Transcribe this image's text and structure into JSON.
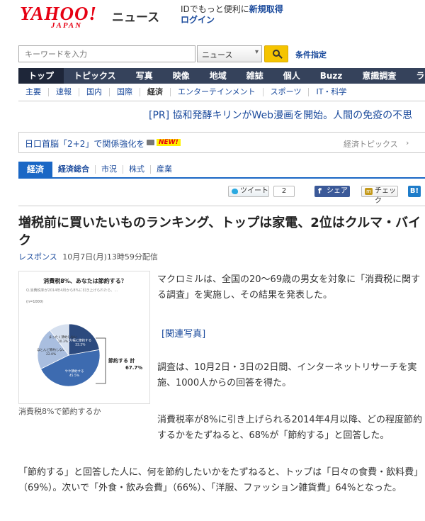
{
  "header": {
    "logo_main": "YAHOO!",
    "logo_sub": "JAPAN",
    "logo_news": "ニュース",
    "account_text": "IDでもっと便利に",
    "register_link": "新規取得",
    "login_link": "ログイン"
  },
  "search": {
    "placeholder": "キーワードを入力",
    "category": "ニュース",
    "options_link": "条件指定"
  },
  "main_nav": [
    "トップ",
    "トピックス",
    "写真",
    "映像",
    "地域",
    "雑誌",
    "個人",
    "Buzz",
    "意識調査",
    "ランキ"
  ],
  "sub_nav": [
    "主要",
    "速報",
    "国内",
    "国際",
    "経済",
    "エンターテインメント",
    "スポーツ",
    "IT・科学"
  ],
  "pr_text": "[PR] 協和発酵キリンがWeb漫画を開始。人間の免疫の不思",
  "topic": {
    "headline": "日口首脳「2+2」で関係強化を",
    "new_badge": "NEW!",
    "right_label": "経済トピックス"
  },
  "category_bar": {
    "tab": "経済",
    "items": [
      "経済総合",
      "市況",
      "株式",
      "産業"
    ]
  },
  "share": {
    "tweet_label": "ツイート",
    "tweet_count": "2",
    "facebook_label": "シェア",
    "mixi_label": "チェック",
    "hatena_label": "B!"
  },
  "article": {
    "title": "増税前に買いたいものランキング、トップは家電、2位はクルマ・バイク",
    "source": "レスポンス",
    "date": "10月7日(月)13時59分配信",
    "caption": "消費税8%で節約するか",
    "para1": "マクロミルは、全国の20～69歳の男女を対象に「消費税に関する調査」を実施し、その結果を発表した。",
    "related": "[関連写真]",
    "para2": "調査は、10月2日・3日の2日間、インターネットリサーチを実施、1000人からの回答を得た。",
    "para3": "消費税率が8%に引き上げられる2014年4月以降、どの程度節約するかをたずねると、68%が「節約する」と回答した。",
    "para4": "「節約する」と回答した人に、何を節約したいかをたずねると、トップは「日々の食費・飲料費」（69%）。次いで「外食・飲み会費」（66%）、「洋服、ファッション雑貨費」64%となった。"
  },
  "figure": {
    "title": "消費税8%、あなたは節約する？",
    "note": "Q.消費税率が2014年4月から8%に引き上げられたら、…",
    "n": "(n=1000)",
    "total_label": "節約する 計",
    "total_value": "67.7%"
  },
  "chart_data": {
    "type": "pie",
    "slices": [
      {
        "label": "大幅に節約する",
        "value": 22.2,
        "color": "#2c4a7e"
      },
      {
        "label": "やや節約する",
        "value": 45.5,
        "color": "#3d6bb0"
      },
      {
        "label": "ほとんど節約しない",
        "value": 22.0,
        "color": "#a9bedf"
      },
      {
        "label": "まったく節約しない",
        "value": 10.3,
        "color": "#d6e0ef"
      }
    ]
  }
}
